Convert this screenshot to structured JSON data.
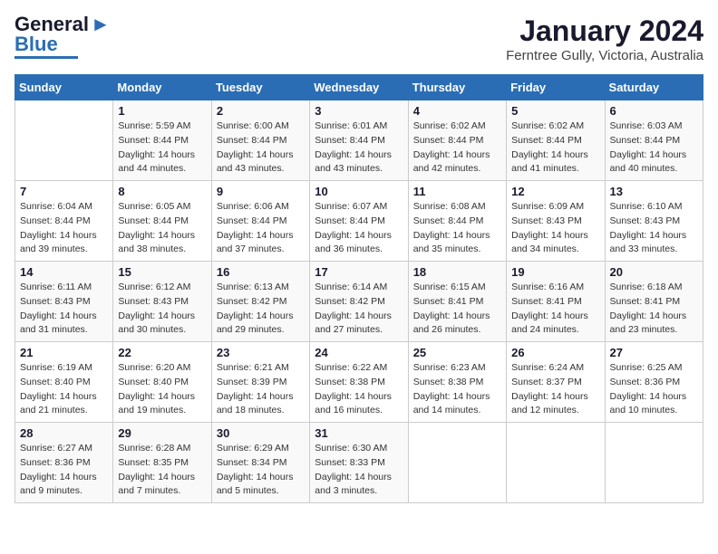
{
  "header": {
    "logo_line1": "General",
    "logo_line2": "Blue",
    "title": "January 2024",
    "subtitle": "Ferntree Gully, Victoria, Australia"
  },
  "days_of_week": [
    "Sunday",
    "Monday",
    "Tuesday",
    "Wednesday",
    "Thursday",
    "Friday",
    "Saturday"
  ],
  "weeks": [
    [
      {
        "day": "",
        "info": ""
      },
      {
        "day": "1",
        "info": "Sunrise: 5:59 AM\nSunset: 8:44 PM\nDaylight: 14 hours\nand 44 minutes."
      },
      {
        "day": "2",
        "info": "Sunrise: 6:00 AM\nSunset: 8:44 PM\nDaylight: 14 hours\nand 43 minutes."
      },
      {
        "day": "3",
        "info": "Sunrise: 6:01 AM\nSunset: 8:44 PM\nDaylight: 14 hours\nand 43 minutes."
      },
      {
        "day": "4",
        "info": "Sunrise: 6:02 AM\nSunset: 8:44 PM\nDaylight: 14 hours\nand 42 minutes."
      },
      {
        "day": "5",
        "info": "Sunrise: 6:02 AM\nSunset: 8:44 PM\nDaylight: 14 hours\nand 41 minutes."
      },
      {
        "day": "6",
        "info": "Sunrise: 6:03 AM\nSunset: 8:44 PM\nDaylight: 14 hours\nand 40 minutes."
      }
    ],
    [
      {
        "day": "7",
        "info": "Sunrise: 6:04 AM\nSunset: 8:44 PM\nDaylight: 14 hours\nand 39 minutes."
      },
      {
        "day": "8",
        "info": "Sunrise: 6:05 AM\nSunset: 8:44 PM\nDaylight: 14 hours\nand 38 minutes."
      },
      {
        "day": "9",
        "info": "Sunrise: 6:06 AM\nSunset: 8:44 PM\nDaylight: 14 hours\nand 37 minutes."
      },
      {
        "day": "10",
        "info": "Sunrise: 6:07 AM\nSunset: 8:44 PM\nDaylight: 14 hours\nand 36 minutes."
      },
      {
        "day": "11",
        "info": "Sunrise: 6:08 AM\nSunset: 8:44 PM\nDaylight: 14 hours\nand 35 minutes."
      },
      {
        "day": "12",
        "info": "Sunrise: 6:09 AM\nSunset: 8:43 PM\nDaylight: 14 hours\nand 34 minutes."
      },
      {
        "day": "13",
        "info": "Sunrise: 6:10 AM\nSunset: 8:43 PM\nDaylight: 14 hours\nand 33 minutes."
      }
    ],
    [
      {
        "day": "14",
        "info": "Sunrise: 6:11 AM\nSunset: 8:43 PM\nDaylight: 14 hours\nand 31 minutes."
      },
      {
        "day": "15",
        "info": "Sunrise: 6:12 AM\nSunset: 8:43 PM\nDaylight: 14 hours\nand 30 minutes."
      },
      {
        "day": "16",
        "info": "Sunrise: 6:13 AM\nSunset: 8:42 PM\nDaylight: 14 hours\nand 29 minutes."
      },
      {
        "day": "17",
        "info": "Sunrise: 6:14 AM\nSunset: 8:42 PM\nDaylight: 14 hours\nand 27 minutes."
      },
      {
        "day": "18",
        "info": "Sunrise: 6:15 AM\nSunset: 8:41 PM\nDaylight: 14 hours\nand 26 minutes."
      },
      {
        "day": "19",
        "info": "Sunrise: 6:16 AM\nSunset: 8:41 PM\nDaylight: 14 hours\nand 24 minutes."
      },
      {
        "day": "20",
        "info": "Sunrise: 6:18 AM\nSunset: 8:41 PM\nDaylight: 14 hours\nand 23 minutes."
      }
    ],
    [
      {
        "day": "21",
        "info": "Sunrise: 6:19 AM\nSunset: 8:40 PM\nDaylight: 14 hours\nand 21 minutes."
      },
      {
        "day": "22",
        "info": "Sunrise: 6:20 AM\nSunset: 8:40 PM\nDaylight: 14 hours\nand 19 minutes."
      },
      {
        "day": "23",
        "info": "Sunrise: 6:21 AM\nSunset: 8:39 PM\nDaylight: 14 hours\nand 18 minutes."
      },
      {
        "day": "24",
        "info": "Sunrise: 6:22 AM\nSunset: 8:38 PM\nDaylight: 14 hours\nand 16 minutes."
      },
      {
        "day": "25",
        "info": "Sunrise: 6:23 AM\nSunset: 8:38 PM\nDaylight: 14 hours\nand 14 minutes."
      },
      {
        "day": "26",
        "info": "Sunrise: 6:24 AM\nSunset: 8:37 PM\nDaylight: 14 hours\nand 12 minutes."
      },
      {
        "day": "27",
        "info": "Sunrise: 6:25 AM\nSunset: 8:36 PM\nDaylight: 14 hours\nand 10 minutes."
      }
    ],
    [
      {
        "day": "28",
        "info": "Sunrise: 6:27 AM\nSunset: 8:36 PM\nDaylight: 14 hours\nand 9 minutes."
      },
      {
        "day": "29",
        "info": "Sunrise: 6:28 AM\nSunset: 8:35 PM\nDaylight: 14 hours\nand 7 minutes."
      },
      {
        "day": "30",
        "info": "Sunrise: 6:29 AM\nSunset: 8:34 PM\nDaylight: 14 hours\nand 5 minutes."
      },
      {
        "day": "31",
        "info": "Sunrise: 6:30 AM\nSunset: 8:33 PM\nDaylight: 14 hours\nand 3 minutes."
      },
      {
        "day": "",
        "info": ""
      },
      {
        "day": "",
        "info": ""
      },
      {
        "day": "",
        "info": ""
      }
    ]
  ]
}
